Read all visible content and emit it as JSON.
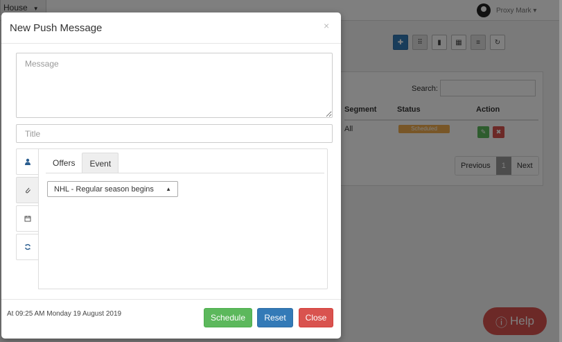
{
  "background": {
    "house_dropdown": "House",
    "user_name": "Proxy Mark ▾",
    "toolbar": {
      "icons": [
        "plus-icon",
        "scatter-chart-icon",
        "bar-chart-icon",
        "calendar-icon",
        "list-icon",
        "refresh-icon"
      ]
    },
    "table": {
      "search_label": "Search:",
      "columns": [
        "Segment",
        "Status",
        "Action"
      ],
      "row": {
        "segment": "All",
        "status": "Scheduled"
      }
    },
    "pagination": {
      "previous": "Previous",
      "current": "1",
      "next": "Next"
    },
    "help_label": "Help"
  },
  "modal": {
    "title": "New Push Message",
    "close_glyph": "×",
    "message_placeholder": "Message",
    "title_placeholder": "Title",
    "side_tabs": [
      {
        "name": "audience",
        "icon": "user-icon"
      },
      {
        "name": "attachment",
        "icon": "paperclip-icon"
      },
      {
        "name": "calendar",
        "icon": "calendar-icon"
      },
      {
        "name": "repeat",
        "icon": "refresh-icon"
      }
    ],
    "inner_tabs": {
      "offers": "Offers",
      "event": "Event"
    },
    "event_select_value": "NHL - Regular season begins",
    "timestamp": "At 09:25 AM Monday 19 August 2019",
    "buttons": {
      "schedule": "Schedule",
      "reset": "Reset",
      "close": "Close"
    },
    "colors": {
      "success": "#5cb85c",
      "primary": "#337ab7",
      "danger": "#d9534f"
    }
  }
}
